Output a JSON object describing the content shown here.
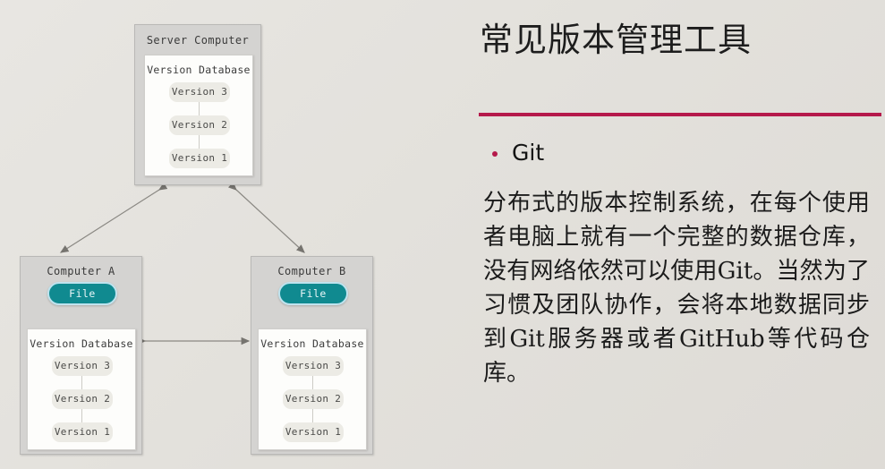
{
  "slide": {
    "background_color": "#e4e2de",
    "accent_color": "#b5194b",
    "file_color": "#108a90"
  },
  "panel": {
    "title": "常见版本管理工具",
    "bullet": {
      "dot_icon": "bullet-dot-icon",
      "label": "Git"
    },
    "body": "分布式的版本控制系统，在每个使用者电脑上就有一个完整的数据仓库，没有网络依然可以使用Git。当然为了习惯及团队协作，会将本地数据同步到Git服务器或者GitHub等代码仓库。"
  },
  "diagram": {
    "server": {
      "title": "Server Computer",
      "database": {
        "title": "Version Database",
        "versions": [
          "Version 3",
          "Version 2",
          "Version 1"
        ]
      }
    },
    "computer_a": {
      "title": "Computer A",
      "file_label": "File",
      "database": {
        "title": "Version Database",
        "versions": [
          "Version 3",
          "Version 2",
          "Version 1"
        ]
      }
    },
    "computer_b": {
      "title": "Computer B",
      "file_label": "File",
      "database": {
        "title": "Version Database",
        "versions": [
          "Version 3",
          "Version 2",
          "Version 1"
        ]
      }
    },
    "connectors": [
      {
        "name": "server-to-computer-a",
        "type": "double-arrow"
      },
      {
        "name": "server-to-computer-b",
        "type": "double-arrow"
      },
      {
        "name": "computer-a-to-computer-b",
        "type": "double-arrow"
      },
      {
        "name": "db-to-file-a",
        "type": "single-arrow-up"
      },
      {
        "name": "db-to-file-b",
        "type": "single-arrow-up"
      }
    ]
  }
}
